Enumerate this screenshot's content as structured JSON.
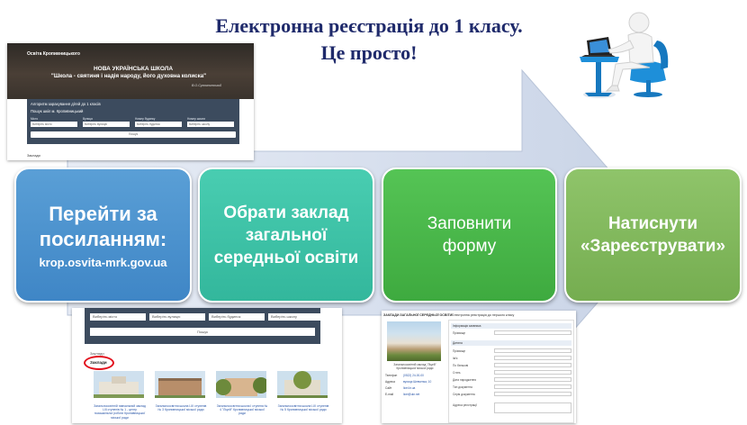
{
  "title": {
    "line1": "Електронна реєстрація до 1 класу.",
    "line2": "Це просто!"
  },
  "screenshot_top": {
    "site_name": "Освіта Кропивницького",
    "hero_line1": "НОВА УКРАЇНСЬКА ШКОЛА",
    "hero_line2": "\"Школа - святиня і надія народу, його духовна колиска\"",
    "hero_signature": "В.О.Сухомлинський",
    "panel_header": "Алгоритм зарахування дітей до 1 класів",
    "panel_subheader": "Пошук шкіл м. Кропивницький",
    "filter_labels": [
      "Місто",
      "Вулиця",
      "Номер будинку",
      "Номер школи"
    ],
    "filter_placeholders": [
      "Виберіть місто",
      "Виберіть вулицю",
      "Виберіть будинок",
      "Виберіть школу"
    ],
    "search_label": "Пошук",
    "below_label": "Заклади"
  },
  "screenshot_bottom_left": {
    "selects": [
      "Виберіть місто",
      "Виберіть вулицю",
      "Виберіть будинок",
      "Виберіть школу"
    ],
    "search_label": "Пошук",
    "section_label": "Заклади",
    "active_label": "Заклади",
    "cards": [
      "Загальноосвітній навчальний заклад І-ІІІ ступенів № 1 - центр позашкільної роботи Кропивницької міської ради",
      "Загальноосвітня школа І-ІІІ ступенів № 3 Кропивницької міської ради",
      "Загальноосвітня школа І ступеня № 4 \"Ліцей\" Кропивницької міської ради",
      "Загальноосвітня школа І-ІІІ ступенів № 5 Кропивницької міської ради"
    ]
  },
  "screenshot_bottom_right": {
    "header": "ЗАКЛАДИ ЗАГАЛЬНОЇ СЕРЕДНЬОЇ ОСВІТИ",
    "form_header": "Електронна реєстрація до першого класу",
    "caption": "Загальноосвітній заклад \"Ліцей\" Кропивницької міської ради",
    "info_rows": [
      {
        "label": "Телефон",
        "value": "(0522) 24-00-00"
      },
      {
        "label": "Адреса",
        "value": "вулиця Шевченка, 10"
      },
      {
        "label": "Сайт",
        "value": "licei.kr.ua"
      },
      {
        "label": "E-mail",
        "value": "licei@ukr.net"
      }
    ],
    "form_sections": [
      "Інформація заявника",
      "Дитина"
    ],
    "form_labels": [
      "Прізвище",
      "Ім'я",
      "По батькові",
      "Стать",
      "Дата народження",
      "Тип документа",
      "Серія документа",
      "Адреса реєстрації"
    ]
  },
  "steps": [
    {
      "title_line1": "Перейти за",
      "title_line2": "посиланням:",
      "url": "krop.osvita-mrk.gov.ua"
    },
    {
      "title": "Обрати заклад загальної середньої освіти"
    },
    {
      "title": "Заповнити форму"
    },
    {
      "title_line1": "Натиснути",
      "title_line2": "«Зареєструвати»"
    }
  ],
  "colors": {
    "title": "#1f2a6b",
    "step1": "#3f86c6",
    "step2": "#33b79c",
    "step3": "#3eaa3f",
    "step4": "#75ad50",
    "arrow": "#d3dcec",
    "highlight_circle": "#e2111d"
  },
  "icons": [
    "person-with-laptop-icon"
  ]
}
